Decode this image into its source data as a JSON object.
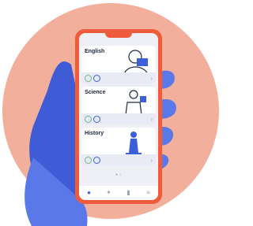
{
  "colors": {
    "circle": "#f2af9c",
    "hand": "#5a78e8",
    "hand_dark": "#3f5bd6",
    "phone_frame": "#ef5b3b",
    "screen": "#eef0f6",
    "card": "#ffffff",
    "card_cta": "#e8ebf5",
    "text": "#202a44",
    "accent_green": "#6bb98a",
    "accent_blue": "#3b5fd9",
    "muted": "#9aa3b8"
  },
  "subjects": [
    {
      "title": "English",
      "illustration": "reading-person-icon"
    },
    {
      "title": "Science",
      "illustration": "scientist-icon"
    },
    {
      "title": "History",
      "illustration": "statue-icon"
    }
  ],
  "card_chevron": "›",
  "pager_text": "● ○",
  "navbar": [
    {
      "icon": "home-icon",
      "glyph": "●"
    },
    {
      "icon": "pin-icon",
      "glyph": "✦"
    },
    {
      "icon": "stats-icon",
      "glyph": "▮"
    },
    {
      "icon": "menu-icon",
      "glyph": "≡"
    }
  ]
}
